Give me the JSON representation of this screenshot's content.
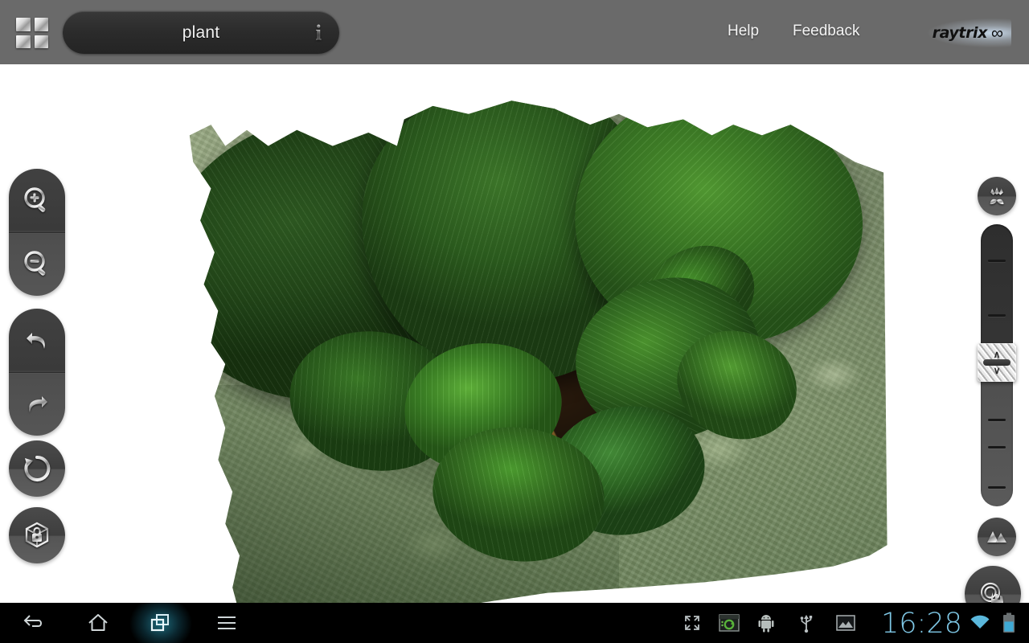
{
  "header": {
    "apps_icon": "apps-grid-icon",
    "title": "plant",
    "info_icon": "info-icon",
    "help_label": "Help",
    "feedback_label": "Feedback",
    "brand_name": "raytrix",
    "brand_symbol": "∞",
    "bg_color": "#6a6a6a"
  },
  "left_toolbar": {
    "items": [
      {
        "name": "zoom-in-button",
        "icon": "magnifier-plus-icon"
      },
      {
        "name": "zoom-out-button",
        "icon": "magnifier-minus-icon"
      },
      {
        "name": "undo-button",
        "icon": "undo-arrow-icon"
      },
      {
        "name": "redo-button",
        "icon": "redo-arrow-icon"
      },
      {
        "name": "reset-view-button",
        "icon": "circular-arrow-icon"
      },
      {
        "name": "lock-view-button",
        "icon": "locked-cube-icon"
      }
    ]
  },
  "right_panel": {
    "flower_icon": "flower-icon",
    "terrain_icon": "mountains-icon",
    "touch_icon": "touch-hand-icon",
    "slider": {
      "name": "depth-slider",
      "thumb_position_percent": 46,
      "tick_count": 6,
      "up_chevron": "∧",
      "down_chevron": "∨"
    }
  },
  "viewport": {
    "name": "3d-model-viewport",
    "content": "3d-depth-reconstruction-of-potted-plant",
    "background_color": "#ffffff"
  },
  "system_bar": {
    "nav": [
      {
        "name": "nav-back-button",
        "icon": "back-arrow-icon",
        "active": false
      },
      {
        "name": "nav-home-button",
        "icon": "home-icon",
        "active": false
      },
      {
        "name": "nav-recents-button",
        "icon": "recent-apps-icon",
        "active": true
      },
      {
        "name": "nav-menu-button",
        "icon": "hamburger-menu-icon",
        "active": false
      }
    ],
    "status_icons": [
      {
        "name": "fullscreen-icon"
      },
      {
        "name": "screen-capture-icon"
      },
      {
        "name": "android-robot-icon"
      },
      {
        "name": "usb-icon"
      },
      {
        "name": "gallery-image-icon"
      }
    ],
    "clock": "16:28",
    "wifi_icon": "wifi-icon",
    "battery_icon": "battery-icon",
    "battery_level_percent": 62,
    "accent_color": "#7fc8e6",
    "recents_glow_color": "#2891aa"
  }
}
